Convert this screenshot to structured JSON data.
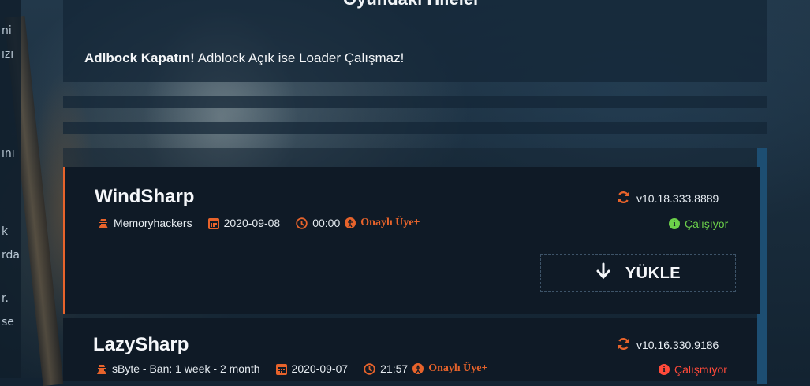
{
  "page": {
    "title": "Oyundaki Hileler",
    "notice_bold": "Adlbock Kapatın!",
    "notice_text": " Adblock Açık ise Loader Çalışmaz!"
  },
  "sidebar_fragments": [
    "ni",
    "ızı",
    "ını",
    "k",
    "rda",
    "r.",
    "se"
  ],
  "cheats": [
    {
      "name": "WindSharp",
      "author": "Memoryhackers",
      "date": "2020-09-08",
      "time": "00:00",
      "access": "Onaylı Üye+",
      "version": "v10.18.333.8889",
      "status": "Çalışıyor",
      "status_kind": "ok",
      "download_label": "YÜKLE"
    },
    {
      "name": "LazySharp",
      "author": "sByte - Ban: 1 week - 2 month",
      "date": "2020-09-07",
      "time": "21:57",
      "access": "Onaylı Üye+",
      "version": "v10.16.330.9186",
      "status": "Çalışmıyor",
      "status_kind": "bad"
    }
  ],
  "icons": {
    "author": "user-secret-icon",
    "date": "calendar-icon",
    "time": "clock-icon",
    "access": "access-icon",
    "version": "refresh-icon",
    "status": "info-icon",
    "download": "arrow-down-icon"
  },
  "colors": {
    "accent": "#e7632b",
    "ok": "#6cd04a",
    "bad": "#ff4a3a",
    "card": "#0f1a26",
    "panel_border": "#1d4e72"
  }
}
